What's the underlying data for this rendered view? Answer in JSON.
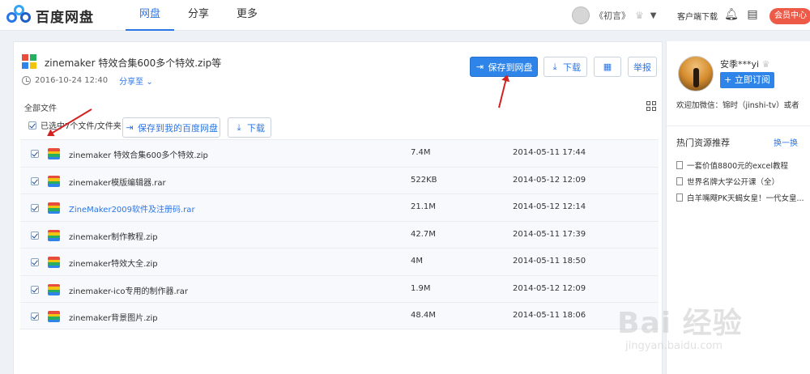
{
  "app": {
    "logo_text": "百度网盘",
    "nav": [
      "网盘",
      "分享",
      "更多"
    ],
    "user_name": "《初言》",
    "client_download": "客户端下载",
    "vip_center": "会员中心",
    "colors": {
      "accent": "#2b76e5",
      "primary_button": "#2e84e8",
      "vip": "#ee5a48",
      "annotation_arrow": "#d3211f"
    }
  },
  "share": {
    "title": "zinemaker 特效合集600多个特效.zip等",
    "date": "2016-10-24 12:40",
    "share_to": "分享至",
    "save_button": "保存到网盘",
    "download_button": "下载",
    "report_button": "举报"
  },
  "file_list": {
    "breadcrumb": "全部文件",
    "selection_label": "已选中7个文件/文件夹",
    "save_to_mine": "保存到我的百度网盘",
    "download": "下载",
    "rows": [
      {
        "name": "zinemaker 特效合集600多个特效.zip",
        "size": "7.4M",
        "date": "2014-05-11 17:44",
        "link": false
      },
      {
        "name": "zinemaker模版编辑器.rar",
        "size": "522KB",
        "date": "2014-05-12 12:09",
        "link": false
      },
      {
        "name": "ZineMaker2009软件及注册码.rar",
        "size": "21.1M",
        "date": "2014-05-12 12:14",
        "link": true
      },
      {
        "name": "zinemaker制作教程.zip",
        "size": "42.7M",
        "date": "2014-05-11 17:39",
        "link": false
      },
      {
        "name": "zinemaker特效大全.zip",
        "size": "4M",
        "date": "2014-05-11 18:50",
        "link": false
      },
      {
        "name": "zinemaker-ico专用的制作器.rar",
        "size": "1.9M",
        "date": "2014-05-12 12:09",
        "link": false
      },
      {
        "name": "zinemaker背景图片.zip",
        "size": "48.4M",
        "date": "2014-05-11 18:06",
        "link": false
      }
    ]
  },
  "sidebar": {
    "user_name": "安季***yi",
    "subscribe_button": "+ 立即订阅",
    "welcome": "欢迎加微信：锦时（jinshi-tv）或者",
    "hot_title": "热门资源推荐",
    "hot_more": "换一换",
    "hot_items": [
      "一套价值8800元的excel教程",
      "世界名牌大学公开课（全）",
      "白羊嘴飕PK天蝎女皇！一代女皇..."
    ]
  },
  "watermark": {
    "main": "Bai 经验",
    "sub": "jingyan.baidu.com"
  }
}
